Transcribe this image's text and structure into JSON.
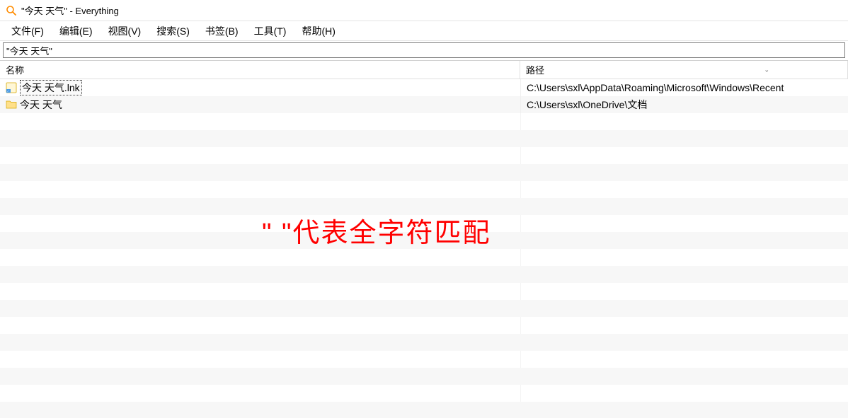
{
  "title": "\"今天 天气\" - Everything",
  "menu": {
    "file": "文件(F)",
    "edit": "编辑(E)",
    "view": "视图(V)",
    "search": "搜索(S)",
    "bookmarks": "书签(B)",
    "tools": "工具(T)",
    "help": "帮助(H)"
  },
  "search_value": "\"今天 天气\"",
  "columns": {
    "name": "名称",
    "path": "路径"
  },
  "results": [
    {
      "name": "今天 天气.lnk",
      "path": "C:\\Users\\sxl\\AppData\\Roaming\\Microsoft\\Windows\\Recent",
      "type": "shortcut",
      "selected": true
    },
    {
      "name": "今天 天气",
      "path": "C:\\Users\\sxl\\OneDrive\\文档",
      "type": "folder",
      "selected": false
    }
  ],
  "annotation": "\" \"代表全字符匹配"
}
